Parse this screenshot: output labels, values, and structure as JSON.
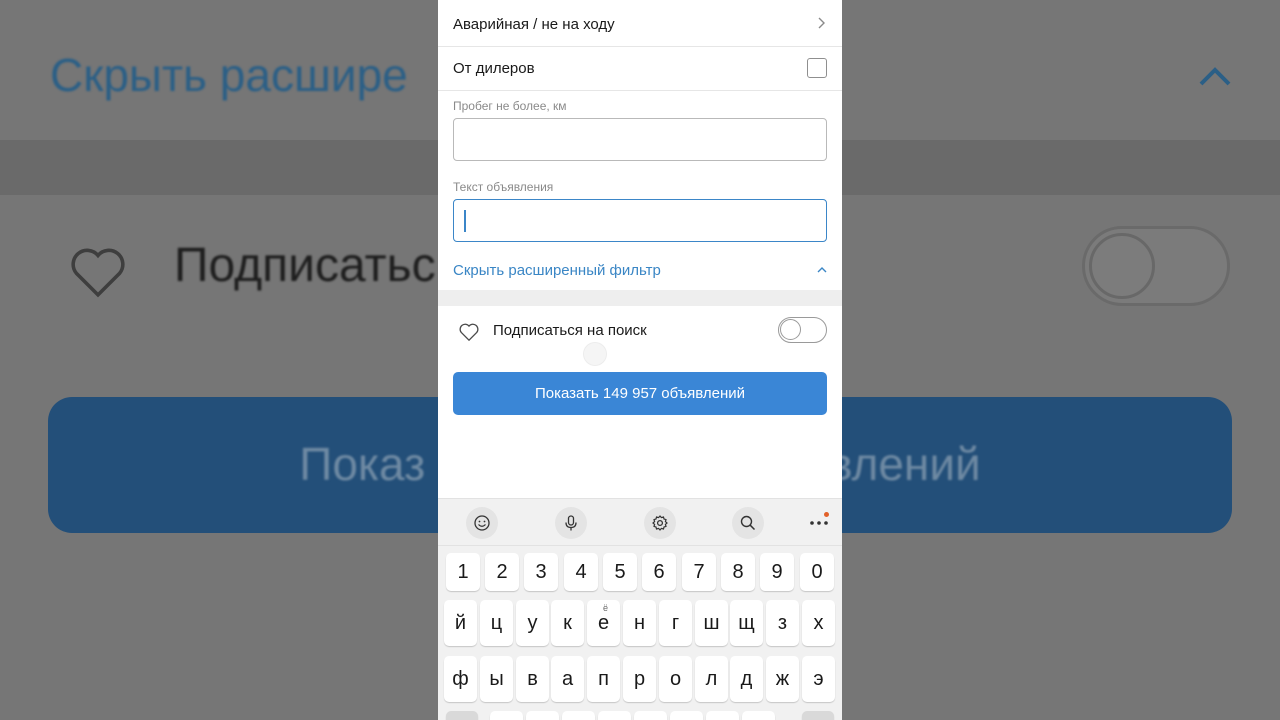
{
  "background": {
    "hide_filter_text": "Скрыть расшире",
    "subscribe_text": "Подписатьс",
    "show_button_left": "Показ",
    "show_button_right": "явлений"
  },
  "filters": {
    "damaged_label": "Аварийная / не на ходу",
    "dealers_label": "От дилеров",
    "dealers_checked": false,
    "mileage_label": "Пробег не более, км",
    "mileage_value": "",
    "ad_text_label": "Текст объявления",
    "ad_text_value": "",
    "hide_advanced_label": "Скрыть расширенный фильтр"
  },
  "subscribe": {
    "label": "Подписаться на поиск",
    "enabled": false
  },
  "show_button": {
    "label": "Показать 149 957 объявлений"
  },
  "colors": {
    "accent": "#3a86d6",
    "link": "#3a86c5",
    "notification_dot": "#e2612a"
  },
  "keyboard": {
    "tools": [
      "emoji-icon",
      "microphone-icon",
      "settings-icon",
      "search-icon",
      "more-icon"
    ],
    "number_row": [
      "1",
      "2",
      "3",
      "4",
      "5",
      "6",
      "7",
      "8",
      "9",
      "0"
    ],
    "row1": [
      "й",
      "ц",
      "у",
      "к",
      "е",
      "н",
      "г",
      "ш",
      "щ",
      "з",
      "х"
    ],
    "row1_hint_e": "ё",
    "row2": [
      "ф",
      "ы",
      "в",
      "а",
      "п",
      "р",
      "о",
      "л",
      "д",
      "ж",
      "э"
    ]
  }
}
